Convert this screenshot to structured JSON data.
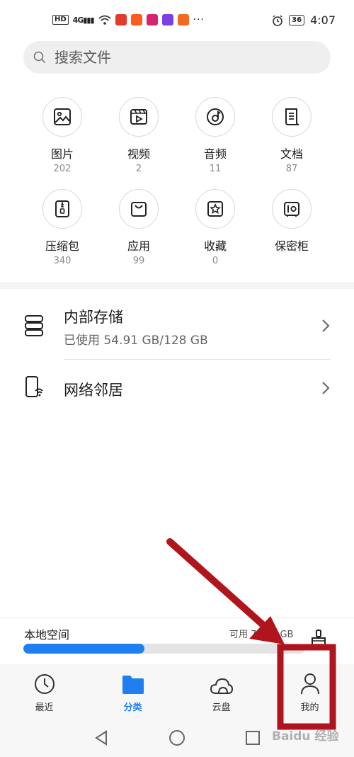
{
  "status_bar": {
    "hd": "HD",
    "network": "4G",
    "dots": "···",
    "battery": "36",
    "time": "4:07"
  },
  "search": {
    "placeholder": "搜索文件"
  },
  "categories": [
    {
      "label": "图片",
      "count": "202",
      "icon": "image-icon"
    },
    {
      "label": "视频",
      "count": "2",
      "icon": "video-icon"
    },
    {
      "label": "音频",
      "count": "11",
      "icon": "audio-icon"
    },
    {
      "label": "文档",
      "count": "87",
      "icon": "document-icon"
    },
    {
      "label": "压缩包",
      "count": "340",
      "icon": "archive-icon"
    },
    {
      "label": "应用",
      "count": "99",
      "icon": "app-bag-icon"
    },
    {
      "label": "收藏",
      "count": "0",
      "icon": "star-icon"
    },
    {
      "label": "保密柜",
      "count": "",
      "icon": "safe-icon"
    }
  ],
  "storage": {
    "internal_title": "内部存储",
    "internal_usage": "已使用 54.91 GB/128 GB",
    "network_title": "网络邻居"
  },
  "local_space": {
    "label": "本地空间",
    "available": "可用 73.09 GB",
    "used_fraction": 0.43
  },
  "bottom_nav": [
    {
      "label": "最近",
      "icon": "clock-icon"
    },
    {
      "label": "分类",
      "icon": "folder-icon"
    },
    {
      "label": "云盘",
      "icon": "cloud-icon"
    },
    {
      "label": "我的",
      "icon": "person-icon"
    }
  ],
  "watermark": "Baidu 经验",
  "colors": {
    "accent": "#1f7ff0",
    "annotation": "#b0141c"
  }
}
